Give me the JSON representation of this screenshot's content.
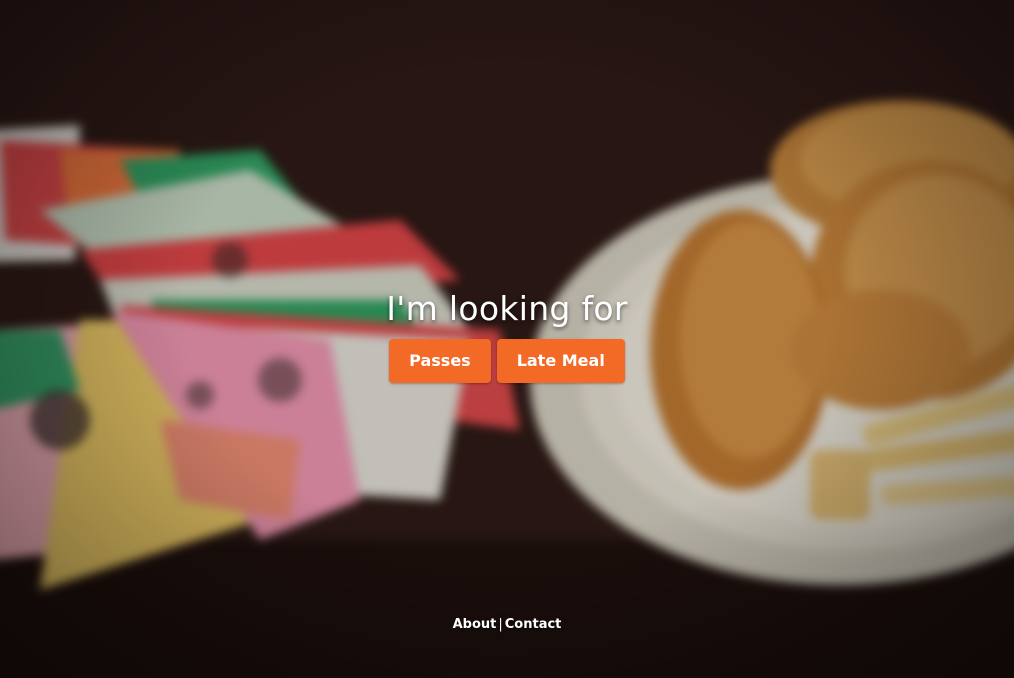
{
  "hero": {
    "title": "I'm looking for",
    "buttons": [
      {
        "label": "Passes"
      },
      {
        "label": "Late Meal"
      }
    ]
  },
  "footer": {
    "links": [
      {
        "label": "About"
      },
      {
        "label": "Contact"
      }
    ],
    "separator": "|"
  },
  "colors": {
    "button_bg": "#f26a25",
    "text": "#ffffff"
  }
}
